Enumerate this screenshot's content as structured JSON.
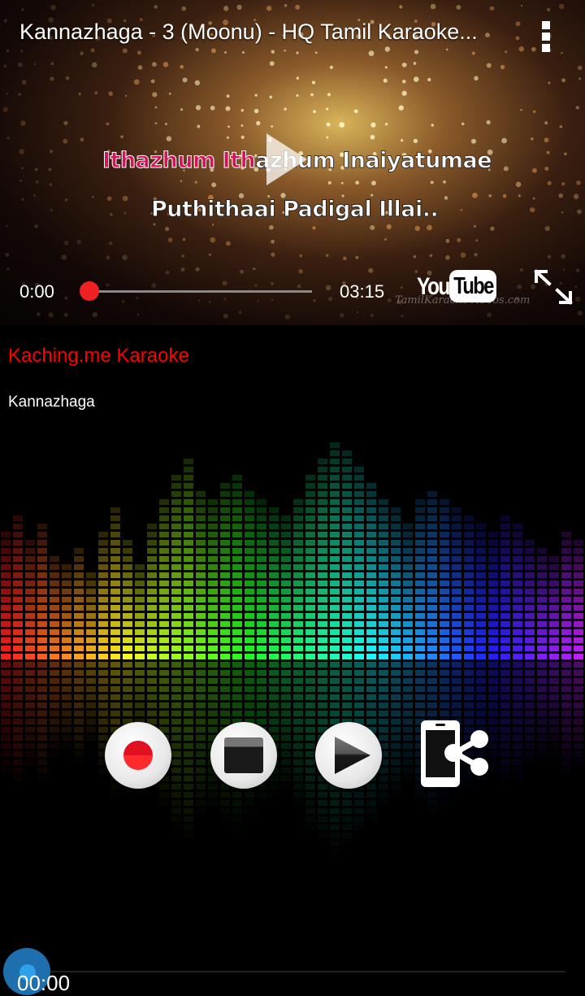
{
  "video": {
    "title": "Kannazhaga - 3 (Moonu) - HQ Tamil Karaoke...",
    "lyric_line1_highlight": "Ithazhum Ith",
    "lyric_line1_rest": "azhum Inaiyatumae",
    "lyric_line2": "Puthithaai Padigal Illai..",
    "current_time": "0:00",
    "duration": "03:15",
    "progress": 0,
    "brand_you": "You",
    "brand_tube": "Tube",
    "watermark": "TamilKaraokeVideos.com"
  },
  "app": {
    "name": "Kaching.me Karaoke",
    "song": "Kannazhaga",
    "elapsed": "00:00",
    "accent_color": "#ff0000",
    "record_progress": 0
  },
  "controls": {
    "record_icon": "record-icon",
    "stop_icon": "stop-icon",
    "play_icon": "play-icon",
    "share_icon": "share-icon"
  }
}
